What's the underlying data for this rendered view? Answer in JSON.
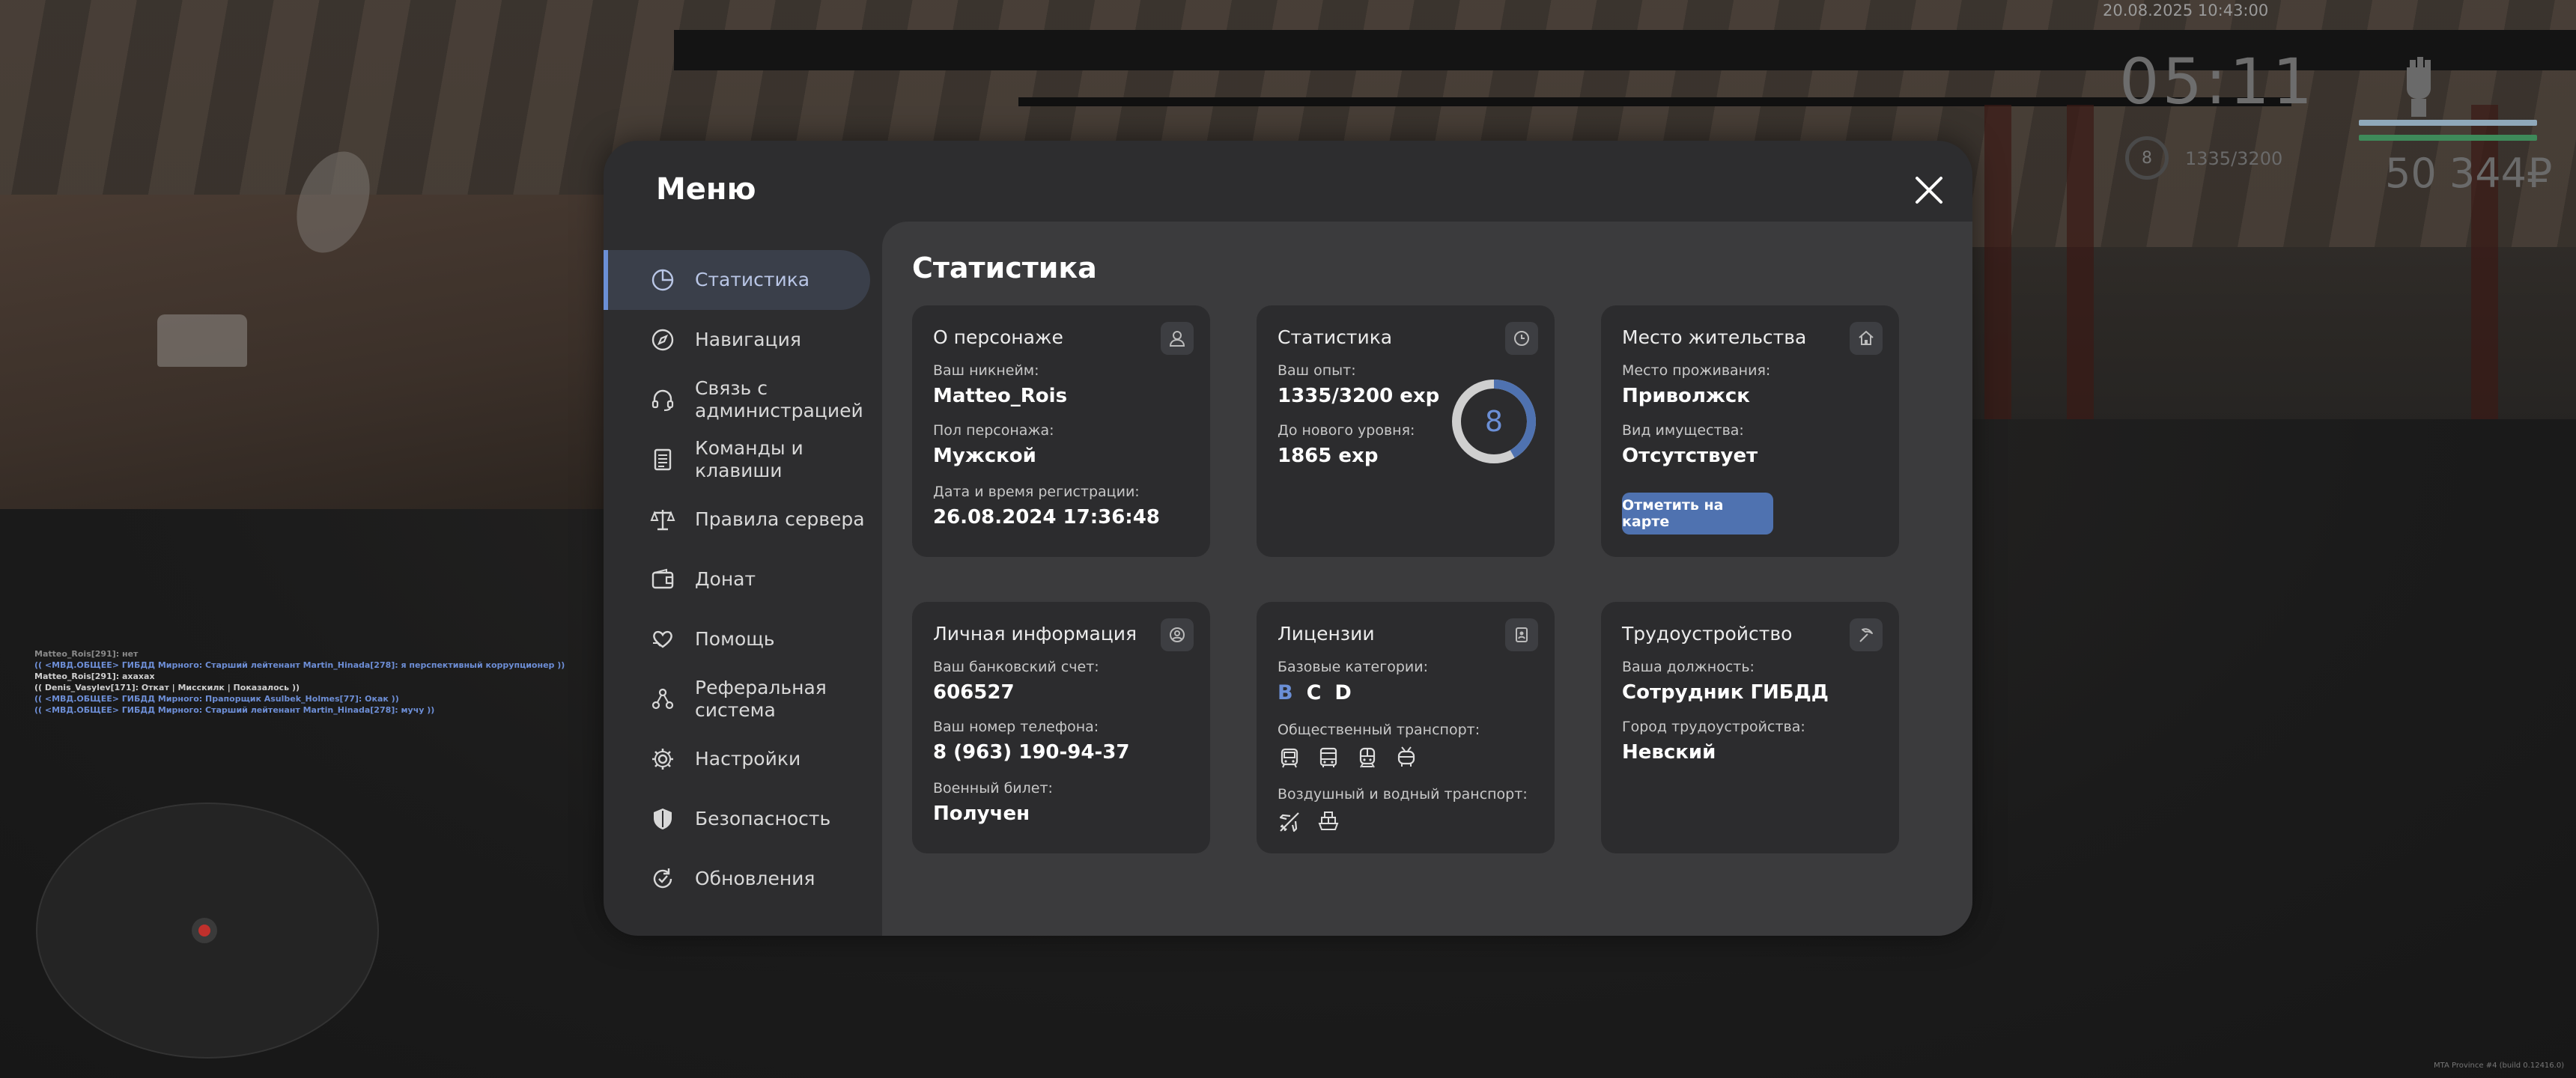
{
  "hud": {
    "date": "20.08.2025 10:43:00",
    "time": "05:11",
    "level": "8",
    "exp": "1335/3200",
    "money": "50 344₽",
    "health_color": "#4aa36a",
    "armor_color": "#9aaec0"
  },
  "chat": [
    {
      "text": "Matteo_Rois[291]: нет",
      "color": "#8a8a8a"
    },
    {
      "text": "(( <МВД.ОБЩЕЕ> ГИБДД Мирного: Старший лейтенант Martin_Hinada[278]: я перспективный коррупционер ))",
      "color": "#6d8ed6"
    },
    {
      "text": "Matteo_Rois[291]: ахахах",
      "color": "#d0d0d0"
    },
    {
      "text": "(( Denis_Vasylev[171]: Откат | Мисскилк | Показалось ))",
      "color": "#d0d0d0"
    },
    {
      "text": "(( <МВД.ОБЩЕЕ> ГИБДД Мирного: Прапорщик Asulbek_Holmes[77]: Окак ))",
      "color": "#6d8ed6"
    },
    {
      "text": "(( <МВД.ОБЩЕЕ> ГИБДД Мирного: Старший лейтенант Martin_Hinada[278]: мучу ))",
      "color": "#6d8ed6"
    }
  ],
  "build": "MTA Province #4 (build 0.12416.0)",
  "menu": {
    "title": "Меню",
    "content_title": "Статистика",
    "nav": [
      {
        "label": "Статистика",
        "icon": "pie-chart-icon",
        "active": true
      },
      {
        "label": "Навигация",
        "icon": "compass-icon"
      },
      {
        "label": "Связь с администрацией",
        "icon": "headset-icon"
      },
      {
        "label": "Команды и клавиши",
        "icon": "document-icon"
      },
      {
        "label": "Правила сервера",
        "icon": "scales-icon"
      },
      {
        "label": "Донат",
        "icon": "wallet-icon"
      },
      {
        "label": "Помощь",
        "icon": "heart-hands-icon"
      },
      {
        "label": "Реферальная система",
        "icon": "referral-icon"
      },
      {
        "label": "Настройки",
        "icon": "gear-icon"
      },
      {
        "label": "Безопасность",
        "icon": "shield-icon"
      },
      {
        "label": "Обновления",
        "icon": "update-icon"
      }
    ]
  },
  "cards": {
    "character": {
      "title": "О персонаже",
      "nick_label": "Ваш никнейм:",
      "nick": "Matteo_Rois",
      "gender_label": "Пол персонажа:",
      "gender": "Мужской",
      "reg_label": "Дата и время регистрации:",
      "reg": "26.08.2024 17:36:48"
    },
    "stats": {
      "title": "Статистика",
      "exp_label": "Ваш опыт:",
      "exp": "1335/3200 exp",
      "next_label": "До нового уровня:",
      "next": "1865 exp",
      "level": "8",
      "progress": 0.417
    },
    "residence": {
      "title": "Место жительства",
      "place_label": "Место проживания:",
      "place": "Приволжск",
      "property_label": "Вид имущества:",
      "property": "Отсутствует",
      "button": "Отметить на карте"
    },
    "personal": {
      "title": "Личная информация",
      "bank_label": "Ваш банковский счет:",
      "bank": "606527",
      "phone_label": "Ваш номер телефона:",
      "phone": "8 (963) 190-94-37",
      "military_label": "Военный билет:",
      "military": "Получен"
    },
    "licenses": {
      "title": "Лицензии",
      "base_label": "Базовые категории:",
      "base": [
        {
          "cat": "B",
          "color": "#6b8fd6"
        },
        {
          "cat": "C",
          "color": "#ffffff"
        },
        {
          "cat": "D",
          "color": "#ffffff"
        }
      ],
      "public_label": "Общественный транспорт:",
      "public_icons": [
        "tram-icon",
        "bus-icon",
        "train-icon",
        "trolleybus-icon"
      ],
      "air_label": "Воздушный и водный транспорт:",
      "air_icons": [
        "airplane-icon",
        "boat-icon"
      ]
    },
    "job": {
      "title": "Трудоустройство",
      "position_label": "Ваша должность:",
      "position": "Сотрудник ГИБДД",
      "city_label": "Город трудоустройства:",
      "city": "Невский"
    }
  },
  "accent_color": "#6b8fd6"
}
